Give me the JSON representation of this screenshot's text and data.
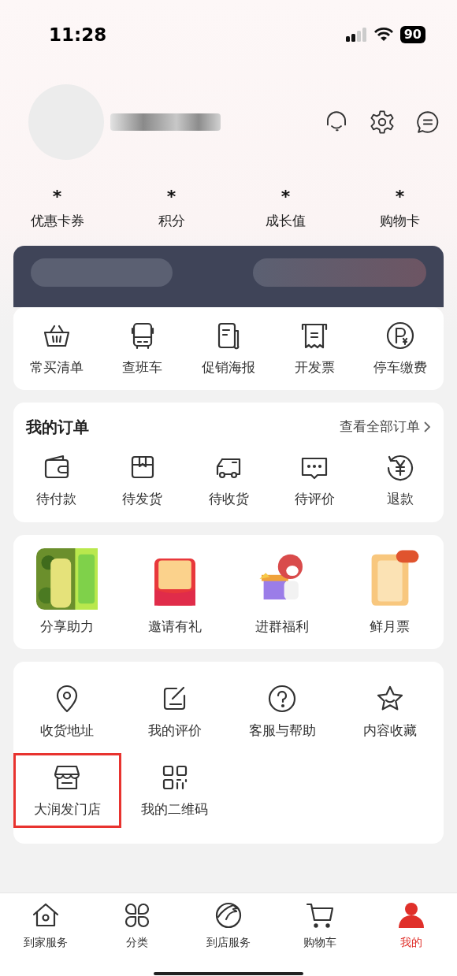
{
  "status_bar": {
    "time": "11:28",
    "battery": "90"
  },
  "stats": [
    {
      "value": "*",
      "label": "优惠卡券"
    },
    {
      "value": "*",
      "label": "积分"
    },
    {
      "value": "*",
      "label": "成长值"
    },
    {
      "value": "*",
      "label": "购物卡"
    }
  ],
  "tools": [
    {
      "label": "常买清单"
    },
    {
      "label": "查班车"
    },
    {
      "label": "促销海报"
    },
    {
      "label": "开发票"
    },
    {
      "label": "停车缴费"
    }
  ],
  "orders": {
    "title": "我的订单",
    "view_all": "查看全部订单",
    "items": [
      {
        "label": "待付款"
      },
      {
        "label": "待发货"
      },
      {
        "label": "待收货"
      },
      {
        "label": "待评价"
      },
      {
        "label": "退款"
      }
    ]
  },
  "promos": [
    {
      "kind": "picture",
      "label": "分享助力"
    },
    {
      "kind": "picture",
      "label": "邀请有礼"
    },
    {
      "kind": "picture",
      "label": "进群福利"
    },
    {
      "kind": "picture",
      "label": "鲜月票"
    }
  ],
  "services": [
    {
      "label": "收货地址",
      "highlighted": false
    },
    {
      "label": "我的评价",
      "highlighted": false
    },
    {
      "label": "客服与帮助",
      "highlighted": false
    },
    {
      "label": "内容收藏",
      "highlighted": false
    },
    {
      "label": "大润发门店",
      "highlighted": true
    },
    {
      "label": "我的二维码",
      "highlighted": false
    }
  ],
  "tab_bar": [
    {
      "label": "到家服务",
      "selected": false
    },
    {
      "label": "分类",
      "selected": false
    },
    {
      "label": "到店服务",
      "selected": false
    },
    {
      "label": "购物车",
      "selected": false
    },
    {
      "label": "我的",
      "selected": true
    }
  ]
}
